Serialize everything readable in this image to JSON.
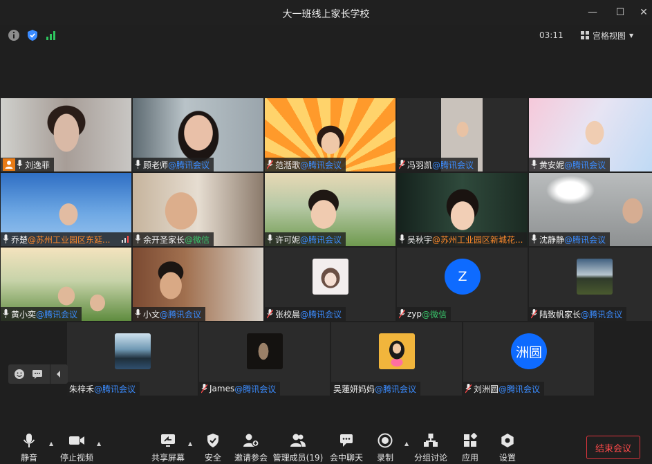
{
  "window": {
    "title": "大一班线上家长学校",
    "controls": [
      "minimize-icon",
      "maximize-icon",
      "close-icon"
    ]
  },
  "infobar": {
    "time": "03:11",
    "view_label": "宫格视图",
    "icons": [
      "info-icon",
      "shield-icon",
      "signal-icon"
    ]
  },
  "participants": [
    {
      "name": "刘逸菲",
      "source": "",
      "host": true
    },
    {
      "name": "顾老师",
      "source": "@腾讯会议"
    },
    {
      "name": "范湉歌",
      "source": "@腾讯会议"
    },
    {
      "name": "冯羽凯",
      "source": "@腾讯会议"
    },
    {
      "name": "黄安妮",
      "source": "@腾讯会议"
    },
    {
      "name": "乔楚",
      "source": "@苏州工业园区东延..."
    },
    {
      "name": "余开圣家长",
      "source": "@微信"
    },
    {
      "name": "许可妮",
      "source": "@腾讯会议"
    },
    {
      "name": "吴秋宇",
      "source": "@苏州工业园区新城花..."
    },
    {
      "name": "沈静静",
      "source": "@腾讯会议"
    },
    {
      "name": "黄小奕",
      "source": "@腾讯会议"
    },
    {
      "name": "小文",
      "source": "@腾讯会议"
    },
    {
      "name": "张校晨",
      "source": "@腾讯会议"
    },
    {
      "name": "zyp",
      "source": "@微信",
      "avatar_text": "Z"
    },
    {
      "name": "陆致帆家长",
      "source": "@腾讯会议"
    },
    {
      "name": "朱梓禾",
      "source": "@腾讯会议"
    },
    {
      "name": "James",
      "source": "@腾讯会议"
    },
    {
      "name": "吴蓮妍妈妈",
      "source": "@腾讯会议"
    },
    {
      "name": "刘洲圆",
      "source": "@腾讯会议",
      "avatar_text": "洲圆"
    }
  ],
  "toolbar": {
    "mute": "静音",
    "stop_video": "停止视频",
    "share_screen": "共享屏幕",
    "security": "安全",
    "invite": "邀请参会",
    "manage_members": "管理成员(19)",
    "chat": "会中聊天",
    "record": "录制",
    "breakout": "分组讨论",
    "apps": "应用",
    "settings": "设置",
    "end_meeting": "结束会议"
  },
  "colors": {
    "accent": "#3b8cff",
    "end": "#e0353d",
    "host_badge": "#e87b16"
  }
}
